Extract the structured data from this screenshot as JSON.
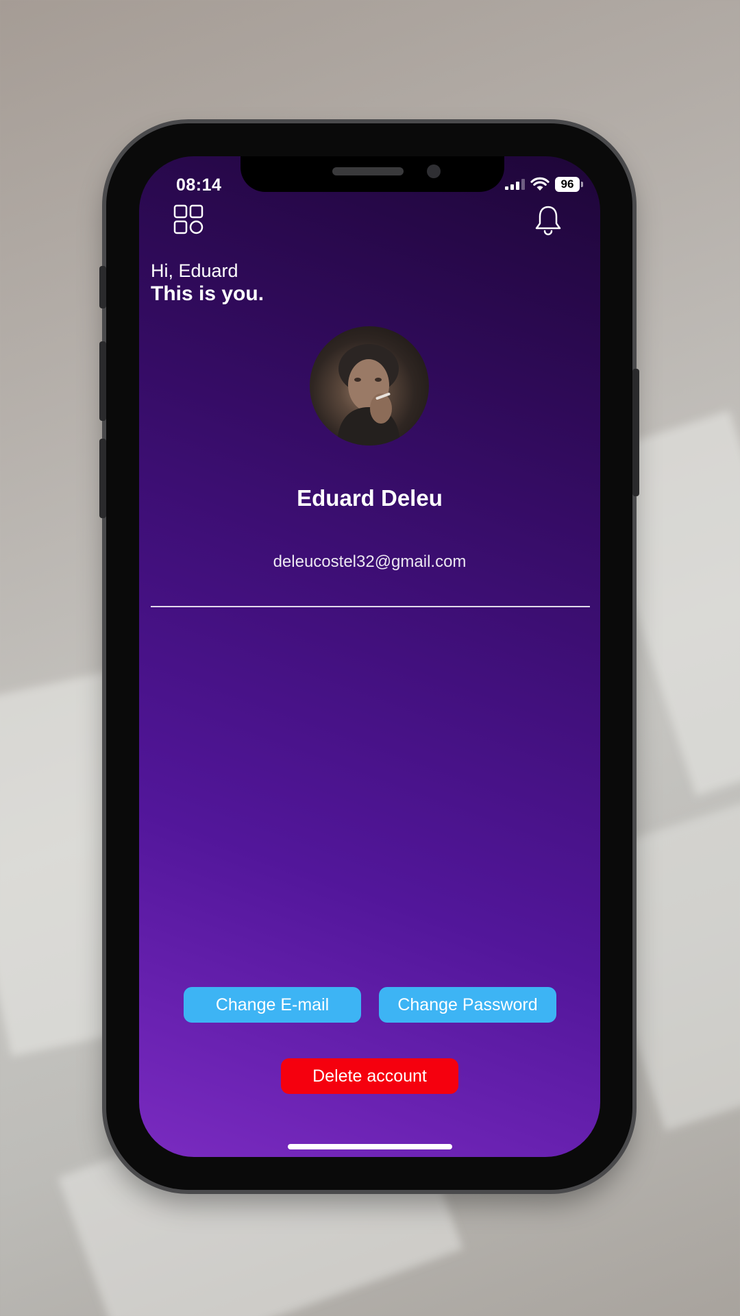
{
  "status_bar": {
    "time": "08:14",
    "battery": "96",
    "icons": [
      "signal-icon",
      "wifi-icon",
      "battery-icon"
    ]
  },
  "header": {
    "menu_icon": "grid-menu-icon",
    "notification_icon": "bell-icon"
  },
  "greeting": {
    "line1": "Hi, Eduard",
    "line2": "This is you."
  },
  "profile": {
    "name": "Eduard Deleu",
    "email": "deleucostel32@gmail.com"
  },
  "actions": {
    "change_email": "Change E-mail",
    "change_password": "Change Password",
    "delete_account": "Delete account"
  },
  "colors": {
    "primary_button": "#3db4f4",
    "danger_button": "#f5000e",
    "background_top": "#1e0638",
    "background_bottom": "#7a2bc0"
  }
}
